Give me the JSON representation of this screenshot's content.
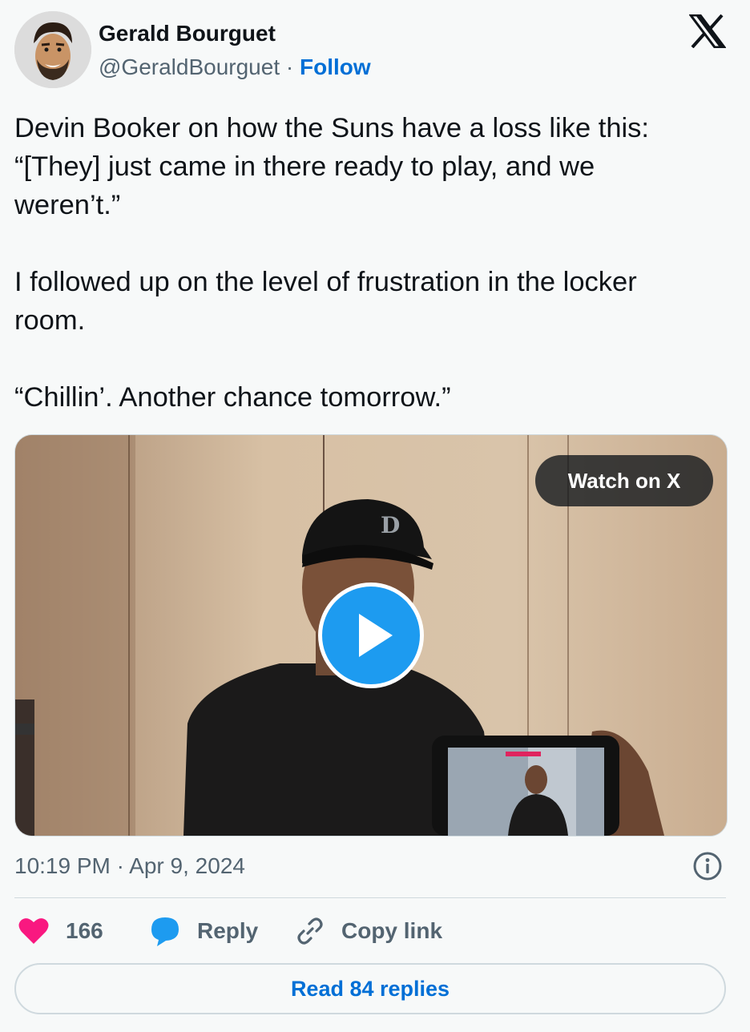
{
  "author": {
    "name": "Gerald Bourguet",
    "handle": "@GeraldBourguet",
    "separator": "·",
    "follow_label": "Follow"
  },
  "brand": {
    "logo_icon": "x-logo-icon"
  },
  "tweet": {
    "lines": [
      "Devin Booker on how the Suns have a loss like this:",
      "“[They] just came in there ready to play, and we",
      "weren’t.”",
      "",
      "I followed up on the level of frustration in the locker",
      "room.",
      "",
      "“Chillin’. Another chance tomorrow.”"
    ]
  },
  "media": {
    "watch_label": "Watch on X",
    "play_icon": "play-icon"
  },
  "meta": {
    "timestamp": "10:19 PM · Apr 9, 2024",
    "info_icon": "info-icon"
  },
  "actions": {
    "like_count": "166",
    "reply_label": "Reply",
    "copy_label": "Copy link",
    "read_replies_label": "Read 84 replies"
  },
  "colors": {
    "link_blue": "#006fd6",
    "play_blue": "#1d9bf0",
    "like_pink": "#f91880",
    "muted": "#536471",
    "background": "#f7f9f9"
  }
}
